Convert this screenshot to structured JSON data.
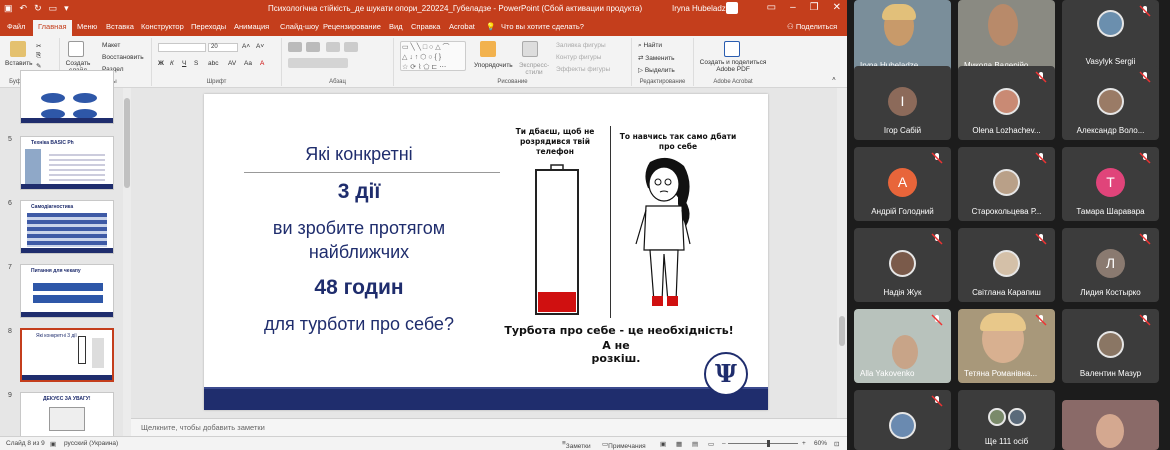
{
  "powerpoint": {
    "window_title": "Психологічна стійкість_де шукати опори_220224_Губеладзе  -  PowerPoint (Сбой активации продукта)",
    "user": "Iryna Hubeladze",
    "tabs": [
      "Файл",
      "Главная",
      "Меню",
      "Вставка",
      "Конструктор",
      "Переходы",
      "Анимация",
      "Слайд-шоу",
      "Рецензирование",
      "Вид",
      "Справка",
      "Acrobat"
    ],
    "active_tab": "Главная",
    "tell_me": "Что вы хотите сделать?",
    "share": "Поделиться",
    "ribbon": {
      "paste": "Вставить",
      "create_slide": "Создать слайд",
      "layout": "Макет",
      "reset": "Восстановить",
      "section": "Раздел",
      "font_size": "20",
      "shapes_arrange": "Упорядочить",
      "express_styles": "Экспресс-стили",
      "shape_fill": "Заливка фигуры",
      "shape_outline": "Контур фигуры",
      "shape_effects": "Эффекты фигуры",
      "find": "Найти",
      "replace": "Заменить",
      "select": "Выделить",
      "create_pdf": "Создать и поделиться Adobe PDF",
      "groups": [
        "Буфер обмена",
        "Слайды",
        "Шрифт",
        "Абзац",
        "Рисование",
        "Редактирование",
        "Adobe Acrobat"
      ]
    },
    "thumbnails": [
      {
        "num": "",
        "title": ""
      },
      {
        "num": "5",
        "title": "Техніка BASIC Ph"
      },
      {
        "num": "6",
        "title": "Самодіагностика"
      },
      {
        "num": "7",
        "title": "Питання для чекапу"
      },
      {
        "num": "8",
        "title": "Які конкретні 3 дії"
      },
      {
        "num": "9",
        "title": "ДЕКУЄС ЗА УВАГУ!"
      }
    ],
    "slide": {
      "line1": "Які конкретні",
      "line2": "3 дії",
      "line3": "ви зробите протягом",
      "line4": "найближчих",
      "line5": "48 годин",
      "line6": "для турботи про себе?",
      "phone_caption": "Ти дбаєш, щоб не розрядився твій телефон",
      "self_caption": "То навчись так само дбати про себе",
      "bottom_text_1": "Турбота про себе  - це необхідність!",
      "bottom_text_2": "А не розкіш.",
      "logo": "Ψ"
    },
    "notes_placeholder": "Щелкните, чтобы добавить заметки",
    "status": {
      "slide_of": "Слайд 8 из 9",
      "language": "русский (Украина)",
      "notes_btn": "Заметки",
      "comments_btn": "Примечания",
      "zoom": "60%"
    }
  },
  "zoom": {
    "participants": [
      {
        "name": "Iryna Hubeladze",
        "type": "video"
      },
      {
        "name": "Микола Валерійо...",
        "type": "video"
      },
      {
        "name": "Vasylyk Sergii",
        "type": "photo"
      },
      {
        "name": "Ігор Сабій",
        "type": "initial",
        "initial": "І",
        "color": "#8c6a5a"
      },
      {
        "name": "Olena Lozhachev...",
        "type": "photo"
      },
      {
        "name": "Александр Воло...",
        "type": "photo"
      },
      {
        "name": "Андрій Голодний",
        "type": "initial",
        "initial": "А",
        "color": "#e8653a"
      },
      {
        "name": "Старокольцева Р...",
        "type": "photo"
      },
      {
        "name": "Тамара Шаравара",
        "type": "initial",
        "initial": "Т",
        "color": "#e0447a"
      },
      {
        "name": "Надія Жук",
        "type": "photo"
      },
      {
        "name": "Світлана Карапиш",
        "type": "photo"
      },
      {
        "name": "Лидия Костырко",
        "type": "initial",
        "initial": "Л",
        "color": "#8a7a70"
      },
      {
        "name": "Alla Yakovenko",
        "type": "video"
      },
      {
        "name": "Тетяна Романівна...",
        "type": "video"
      },
      {
        "name": "Валентин Мазур",
        "type": "photo"
      },
      {
        "name": "",
        "type": "photo"
      },
      {
        "name": "Ще 111 осіб",
        "type": "more"
      },
      {
        "name": "",
        "type": "video"
      }
    ]
  },
  "colors": {
    "ppt_accent": "#c43e1c",
    "slide_navy": "#1f2d6d",
    "battery_red": "#d01010"
  }
}
